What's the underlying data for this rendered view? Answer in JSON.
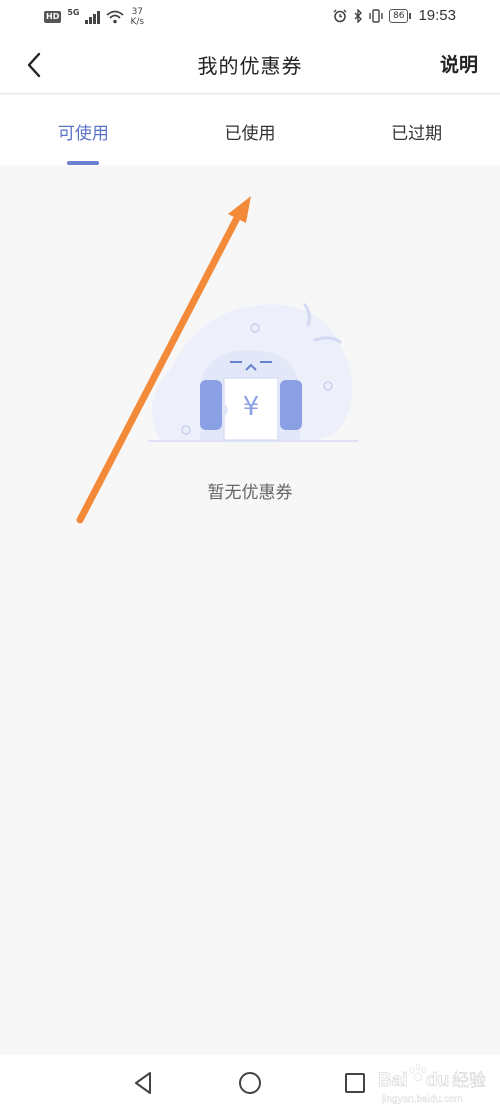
{
  "status_bar": {
    "network_badge": "HD",
    "network_type": "5G",
    "speed_value": "37",
    "speed_unit": "K/s",
    "battery_level": "86",
    "time": "19:53"
  },
  "header": {
    "title": "我的优惠券",
    "help_label": "说明"
  },
  "tabs": [
    {
      "label": "可使用",
      "active": true
    },
    {
      "label": "已使用",
      "active": false
    },
    {
      "label": "已过期",
      "active": false
    }
  ],
  "empty_state": {
    "message": "暂无优惠券",
    "currency_symbol": "¥"
  },
  "colors": {
    "accent": "#5b73c7",
    "tab_indicator": "#6b80d0",
    "page_background": "#f7f7f7",
    "annotation_arrow": "#f38a3a"
  },
  "icons": {
    "back": "chevron-left-icon",
    "nav_back": "triangle-back-icon",
    "nav_home": "circle-home-icon",
    "nav_recent": "square-recent-icon"
  },
  "watermark": {
    "brand": "Baidu",
    "suffix": "经验",
    "url": "jingyan.baidu.com"
  }
}
